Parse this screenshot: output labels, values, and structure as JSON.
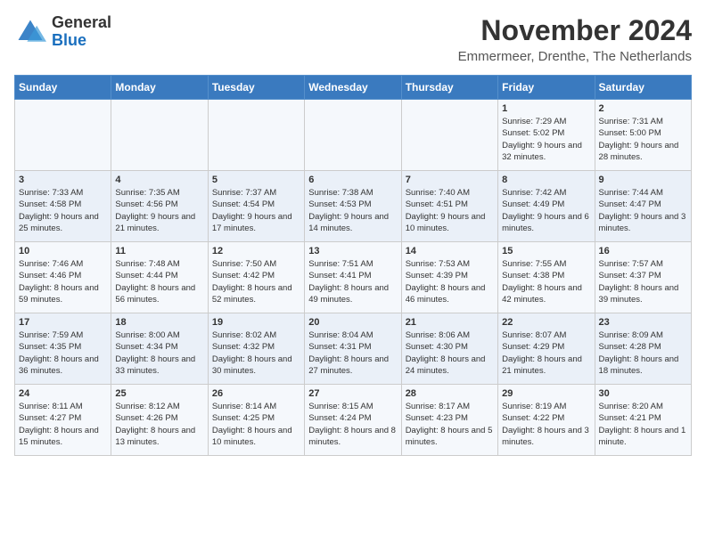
{
  "header": {
    "logo_general": "General",
    "logo_blue": "Blue",
    "month_title": "November 2024",
    "location": "Emmermeer, Drenthe, The Netherlands"
  },
  "days_of_week": [
    "Sunday",
    "Monday",
    "Tuesday",
    "Wednesday",
    "Thursday",
    "Friday",
    "Saturday"
  ],
  "weeks": [
    [
      {
        "day": "",
        "info": ""
      },
      {
        "day": "",
        "info": ""
      },
      {
        "day": "",
        "info": ""
      },
      {
        "day": "",
        "info": ""
      },
      {
        "day": "",
        "info": ""
      },
      {
        "day": "1",
        "info": "Sunrise: 7:29 AM\nSunset: 5:02 PM\nDaylight: 9 hours and 32 minutes."
      },
      {
        "day": "2",
        "info": "Sunrise: 7:31 AM\nSunset: 5:00 PM\nDaylight: 9 hours and 28 minutes."
      }
    ],
    [
      {
        "day": "3",
        "info": "Sunrise: 7:33 AM\nSunset: 4:58 PM\nDaylight: 9 hours and 25 minutes."
      },
      {
        "day": "4",
        "info": "Sunrise: 7:35 AM\nSunset: 4:56 PM\nDaylight: 9 hours and 21 minutes."
      },
      {
        "day": "5",
        "info": "Sunrise: 7:37 AM\nSunset: 4:54 PM\nDaylight: 9 hours and 17 minutes."
      },
      {
        "day": "6",
        "info": "Sunrise: 7:38 AM\nSunset: 4:53 PM\nDaylight: 9 hours and 14 minutes."
      },
      {
        "day": "7",
        "info": "Sunrise: 7:40 AM\nSunset: 4:51 PM\nDaylight: 9 hours and 10 minutes."
      },
      {
        "day": "8",
        "info": "Sunrise: 7:42 AM\nSunset: 4:49 PM\nDaylight: 9 hours and 6 minutes."
      },
      {
        "day": "9",
        "info": "Sunrise: 7:44 AM\nSunset: 4:47 PM\nDaylight: 9 hours and 3 minutes."
      }
    ],
    [
      {
        "day": "10",
        "info": "Sunrise: 7:46 AM\nSunset: 4:46 PM\nDaylight: 8 hours and 59 minutes."
      },
      {
        "day": "11",
        "info": "Sunrise: 7:48 AM\nSunset: 4:44 PM\nDaylight: 8 hours and 56 minutes."
      },
      {
        "day": "12",
        "info": "Sunrise: 7:50 AM\nSunset: 4:42 PM\nDaylight: 8 hours and 52 minutes."
      },
      {
        "day": "13",
        "info": "Sunrise: 7:51 AM\nSunset: 4:41 PM\nDaylight: 8 hours and 49 minutes."
      },
      {
        "day": "14",
        "info": "Sunrise: 7:53 AM\nSunset: 4:39 PM\nDaylight: 8 hours and 46 minutes."
      },
      {
        "day": "15",
        "info": "Sunrise: 7:55 AM\nSunset: 4:38 PM\nDaylight: 8 hours and 42 minutes."
      },
      {
        "day": "16",
        "info": "Sunrise: 7:57 AM\nSunset: 4:37 PM\nDaylight: 8 hours and 39 minutes."
      }
    ],
    [
      {
        "day": "17",
        "info": "Sunrise: 7:59 AM\nSunset: 4:35 PM\nDaylight: 8 hours and 36 minutes."
      },
      {
        "day": "18",
        "info": "Sunrise: 8:00 AM\nSunset: 4:34 PM\nDaylight: 8 hours and 33 minutes."
      },
      {
        "day": "19",
        "info": "Sunrise: 8:02 AM\nSunset: 4:32 PM\nDaylight: 8 hours and 30 minutes."
      },
      {
        "day": "20",
        "info": "Sunrise: 8:04 AM\nSunset: 4:31 PM\nDaylight: 8 hours and 27 minutes."
      },
      {
        "day": "21",
        "info": "Sunrise: 8:06 AM\nSunset: 4:30 PM\nDaylight: 8 hours and 24 minutes."
      },
      {
        "day": "22",
        "info": "Sunrise: 8:07 AM\nSunset: 4:29 PM\nDaylight: 8 hours and 21 minutes."
      },
      {
        "day": "23",
        "info": "Sunrise: 8:09 AM\nSunset: 4:28 PM\nDaylight: 8 hours and 18 minutes."
      }
    ],
    [
      {
        "day": "24",
        "info": "Sunrise: 8:11 AM\nSunset: 4:27 PM\nDaylight: 8 hours and 15 minutes."
      },
      {
        "day": "25",
        "info": "Sunrise: 8:12 AM\nSunset: 4:26 PM\nDaylight: 8 hours and 13 minutes."
      },
      {
        "day": "26",
        "info": "Sunrise: 8:14 AM\nSunset: 4:25 PM\nDaylight: 8 hours and 10 minutes."
      },
      {
        "day": "27",
        "info": "Sunrise: 8:15 AM\nSunset: 4:24 PM\nDaylight: 8 hours and 8 minutes."
      },
      {
        "day": "28",
        "info": "Sunrise: 8:17 AM\nSunset: 4:23 PM\nDaylight: 8 hours and 5 minutes."
      },
      {
        "day": "29",
        "info": "Sunrise: 8:19 AM\nSunset: 4:22 PM\nDaylight: 8 hours and 3 minutes."
      },
      {
        "day": "30",
        "info": "Sunrise: 8:20 AM\nSunset: 4:21 PM\nDaylight: 8 hours and 1 minute."
      }
    ]
  ]
}
